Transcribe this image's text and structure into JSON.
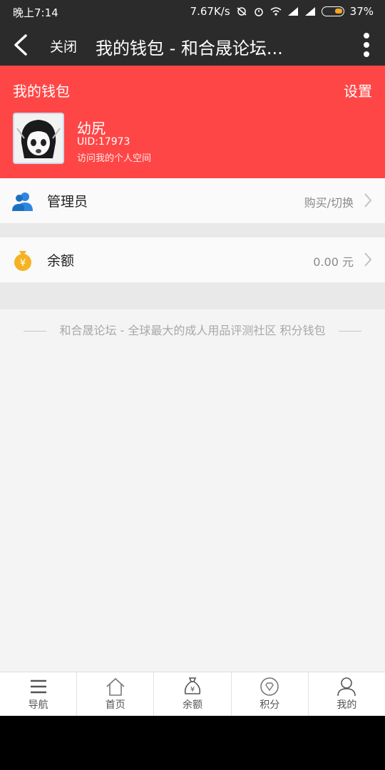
{
  "statusbar": {
    "time": "晚上7:14",
    "speed": "7.67K/s",
    "battery": "37%"
  },
  "navbar": {
    "close_label": "关闭",
    "title": "我的钱包 - 和合晟论坛..."
  },
  "wallet_header": {
    "title": "我的钱包",
    "settings_label": "设置",
    "username": "幼尻",
    "uid": "UID:17973",
    "visit_space": "访问我的个人空间"
  },
  "rows": [
    {
      "label": "管理员",
      "value": "购买/切换"
    },
    {
      "label": "余额",
      "value": "0.00 元"
    }
  ],
  "footer_text": "和合晟论坛 - 全球最大的成人用品评测社区 积分钱包",
  "tabs": [
    {
      "label": "导航"
    },
    {
      "label": "首页"
    },
    {
      "label": "余额"
    },
    {
      "label": "积分"
    },
    {
      "label": "我的"
    }
  ],
  "colors": {
    "header_bg": "#ff4646",
    "navbar_bg": "#2b2b2b",
    "admin_icon": "#2e86de",
    "balance_icon": "#f5b324"
  }
}
